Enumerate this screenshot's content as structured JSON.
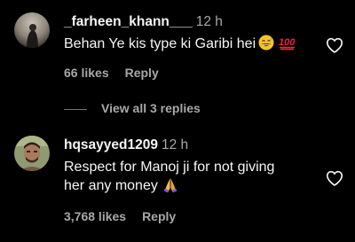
{
  "comments": [
    {
      "username": "_farheen_khann___",
      "time": "12 h",
      "text": "Behan Ye kis type ki Garibi hei",
      "emojis": [
        "grinning-sweat-emoji",
        "hundred-points-emoji"
      ],
      "likes": "66 likes",
      "reply_label": "Reply"
    },
    {
      "username": "hqsayyed1209",
      "time": "12 h",
      "text_line1": "Respect for Manoj ji for not giving",
      "text_line2": "her any money",
      "emojis": [
        "folded-hands-emoji"
      ],
      "likes": "3,768 likes",
      "reply_label": "Reply"
    }
  ],
  "view_replies": "View all 3 replies",
  "colors": {
    "background": "#000000",
    "primary_text": "#f5f5f5",
    "secondary_text": "#a8a8a8"
  }
}
